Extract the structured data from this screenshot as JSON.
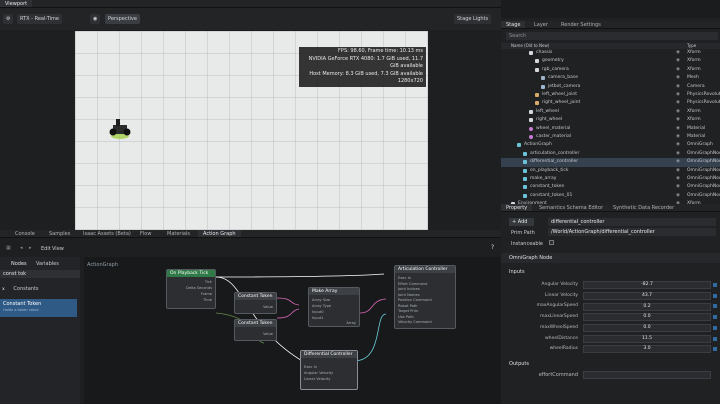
{
  "viewport": {
    "title": "Viewport",
    "renderer": "RTX - Real-Time",
    "camera": "Perspective",
    "lights": "Stage Lights",
    "hud": [
      "FPS: 98.60, Frame time: 10.13 ms",
      "NVIDIA GeForce RTX 4080: 1.7 GiB used, 11.7 GiB available",
      "Host Memory: 8.3 GiB used, 7.3 GiB available",
      "1280x720"
    ]
  },
  "stage": {
    "tabs": [
      "Stage",
      "Layer",
      "Render Settings"
    ],
    "search_placeholder": "Search",
    "col_name": "Name (Old to New)",
    "col_type": "Type",
    "rows": [
      {
        "name": "chassis",
        "type": "Xform",
        "indent": 4,
        "icon": "xform"
      },
      {
        "name": "geometry",
        "type": "Xform",
        "indent": 5,
        "icon": "xform"
      },
      {
        "name": "rgb_camera",
        "type": "Xform",
        "indent": 5,
        "icon": "xform"
      },
      {
        "name": "camera_base",
        "type": "Mesh",
        "indent": 6,
        "icon": "mesh"
      },
      {
        "name": "jetbot_camera",
        "type": "Camera",
        "indent": 6,
        "icon": "camera"
      },
      {
        "name": "left_wheel_joint",
        "type": "PhysicsRevolute",
        "indent": 5,
        "icon": "joint"
      },
      {
        "name": "right_wheel_joint",
        "type": "PhysicsRevolute",
        "indent": 5,
        "icon": "joint"
      },
      {
        "name": "left_wheel",
        "type": "Xform",
        "indent": 4,
        "icon": "xform"
      },
      {
        "name": "right_wheel",
        "type": "Xform",
        "indent": 4,
        "icon": "xform"
      },
      {
        "name": "wheel_material",
        "type": "Material",
        "indent": 4,
        "icon": "mat"
      },
      {
        "name": "caster_material",
        "type": "Material",
        "indent": 4,
        "icon": "mat"
      },
      {
        "name": "ActionGraph",
        "type": "OmniGraph",
        "indent": 2,
        "icon": "graph"
      },
      {
        "name": "articulation_controller",
        "type": "OmniGraphNode",
        "indent": 3,
        "icon": "node"
      },
      {
        "name": "differential_controller",
        "type": "OmniGraphNode",
        "indent": 3,
        "icon": "node",
        "selected": true
      },
      {
        "name": "on_playback_tick",
        "type": "OmniGraphNode",
        "indent": 3,
        "icon": "node"
      },
      {
        "name": "make_array",
        "type": "OmniGraphNode",
        "indent": 3,
        "icon": "node"
      },
      {
        "name": "constant_token",
        "type": "OmniGraphNode",
        "indent": 3,
        "icon": "node"
      },
      {
        "name": "constant_token_01",
        "type": "OmniGraphNode",
        "indent": 3,
        "icon": "node"
      },
      {
        "name": "Environment",
        "type": "Xform",
        "indent": 1,
        "icon": "xform"
      }
    ]
  },
  "property": {
    "tabs": [
      "Property",
      "Semantics Schema Editor",
      "Synthetic Data Recorder"
    ],
    "add_label": "Add",
    "name_value": "differential_controller",
    "prim_path_label": "Prim Path",
    "prim_path_value": "/World/ActionGraph/differential_controller",
    "instanceable_label": "Instanceable",
    "section_node": "OmniGraph Node",
    "section_inputs": "Inputs",
    "section_outputs": "Outputs",
    "inputs": [
      {
        "label": "Angular Velocity",
        "value": "-82.7"
      },
      {
        "label": "Linear Velocity",
        "value": "43.7"
      },
      {
        "label": "maxAngularSpeed",
        "value": "0.2"
      },
      {
        "label": "maxLinearSpeed",
        "value": "0.0"
      },
      {
        "label": "maxWheelSpeed",
        "value": "0.0"
      },
      {
        "label": "wheelDistance",
        "value": "11.5"
      },
      {
        "label": "wheelRadius",
        "value": "3.0"
      }
    ],
    "output_first": "effortCommand"
  },
  "bottom": {
    "tabs": [
      "Console",
      "Samples",
      "Isaac Assets (Beta)",
      "Flow",
      "Materials",
      "Action Graph"
    ],
    "menu": [
      "Edit",
      "View"
    ],
    "nodes_tab": "Nodes",
    "variables_tab": "Variables",
    "search_value": "const tok",
    "palette": [
      "Constants",
      "Constant Token"
    ],
    "palette_desc": "Holds a token value",
    "graph_label": "ActionGraph",
    "nodes": {
      "tick": "On Playback Tick",
      "const1": "Constant Token",
      "const2": "Constant Token",
      "array": "Make Array",
      "artic": "Articulation Controller",
      "diff": "Differential Controller"
    },
    "pins": {
      "tick": [
        "Tick",
        "Delta Seconds",
        "Frame",
        "Time"
      ],
      "const_value": "Value",
      "array": [
        "Array Size",
        "Array Type",
        "Input0",
        "Input1",
        "Array"
      ],
      "artic": [
        "Exec In",
        "Effort Command",
        "Joint Indices",
        "Joint Names",
        "Position Command",
        "Robot Path",
        "Target Prim",
        "Use Path",
        "Velocity Command"
      ],
      "diff": [
        "Exec In",
        "Angular Velocity",
        "Linear Velocity"
      ]
    }
  }
}
